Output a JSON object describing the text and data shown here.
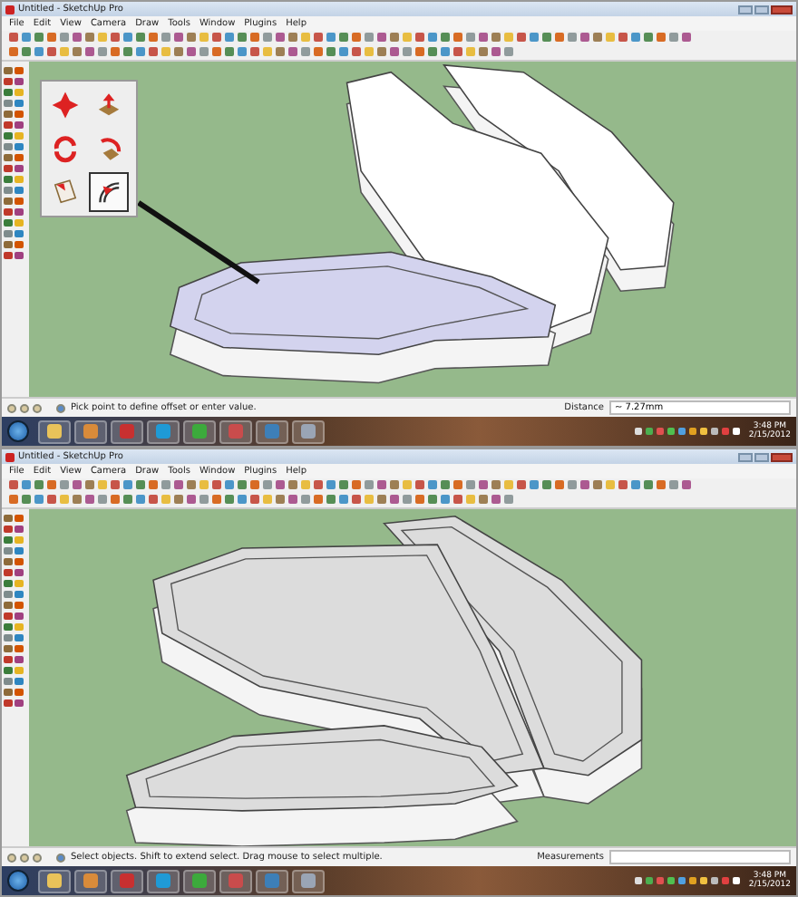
{
  "panels": [
    {
      "window": {
        "title": "Untitled - SketchUp Pro"
      },
      "menu": [
        "File",
        "Edit",
        "View",
        "Camera",
        "Draw",
        "Tools",
        "Window",
        "Plugins",
        "Help"
      ],
      "kind": "top",
      "tool_palette": {
        "tools": [
          {
            "selected": false
          },
          {
            "selected": false
          },
          {
            "selected": false
          },
          {
            "selected": false
          },
          {
            "selected": false
          },
          {
            "selected": true
          }
        ]
      },
      "status": {
        "hint": "Pick point to define offset or enter value.",
        "measure_label": "Distance",
        "measure_value": "~ 7.27mm"
      },
      "clock": {
        "time": "3:48 PM",
        "date": "2/15/2012"
      }
    },
    {
      "window": {
        "title": "Untitled - SketchUp Pro"
      },
      "menu": [
        "File",
        "Edit",
        "View",
        "Camera",
        "Draw",
        "Tools",
        "Window",
        "Plugins",
        "Help"
      ],
      "kind": "bottom",
      "status": {
        "hint": "Select objects. Shift to extend select. Drag mouse to select multiple.",
        "measure_label": "Measurements"
      },
      "clock": {
        "time": "3:48 PM",
        "date": "2/15/2012"
      }
    }
  ]
}
